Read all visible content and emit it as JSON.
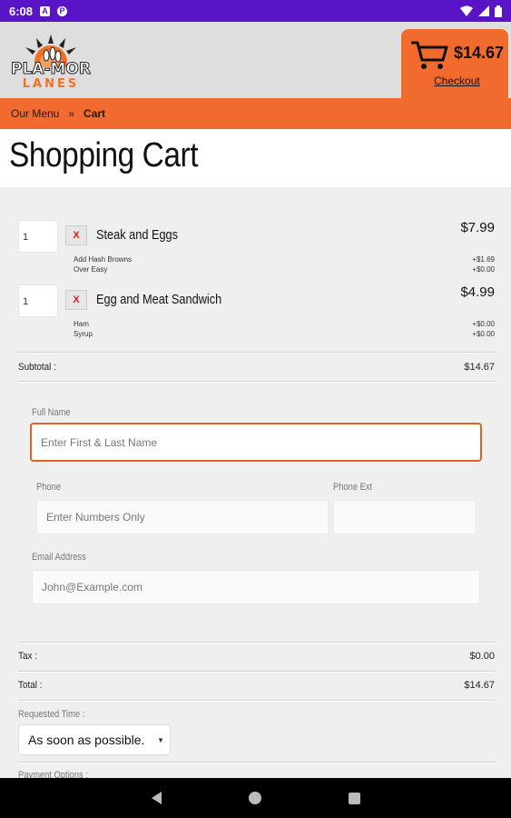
{
  "status": {
    "time": "6:08"
  },
  "header": {
    "logo_text": "PLA-MOR",
    "logo_sub": "LANES",
    "cart_total": "$14.67",
    "checkout_label": "Checkout"
  },
  "breadcrumb": {
    "parent": "Our Menu",
    "separator": "»",
    "current": "Cart"
  },
  "page_title": "Shopping Cart",
  "cart": {
    "items": [
      {
        "qty": "1",
        "remove": "X",
        "name": "Steak and Eggs",
        "price": "$7.99",
        "mods": [
          "Add Hash Browns",
          "Over Easy"
        ],
        "mod_prices": [
          "+$1.69",
          "+$0.00"
        ]
      },
      {
        "qty": "1",
        "remove": "X",
        "name": "Egg and Meat Sandwich",
        "price": "$4.99",
        "mods": [
          "Ham",
          "Syrup"
        ],
        "mod_prices": [
          "+$0.00",
          "+$0.00"
        ]
      }
    ],
    "subtotal_label": "Subtotal :",
    "subtotal": "$14.67"
  },
  "form": {
    "full_name_label": "Full Name",
    "full_name_placeholder": "Enter First & Last Name",
    "phone_label": "Phone",
    "phone_placeholder": "Enter Numbers Only",
    "phone_ext_label": "Phone Ext",
    "email_label": "Email Address",
    "email_placeholder": "John@Example.com"
  },
  "totals": {
    "tax_label": "Tax :",
    "tax": "$0.00",
    "total_label": "Total :",
    "total": "$14.67",
    "requested_time_label": "Requested Time :",
    "requested_time_value": "As soon as possible.",
    "payment_options_label": "Payment Options :"
  },
  "colors": {
    "accent": "#f26b2e",
    "statusbar": "#5a14c8",
    "remove": "#e21b1b"
  }
}
